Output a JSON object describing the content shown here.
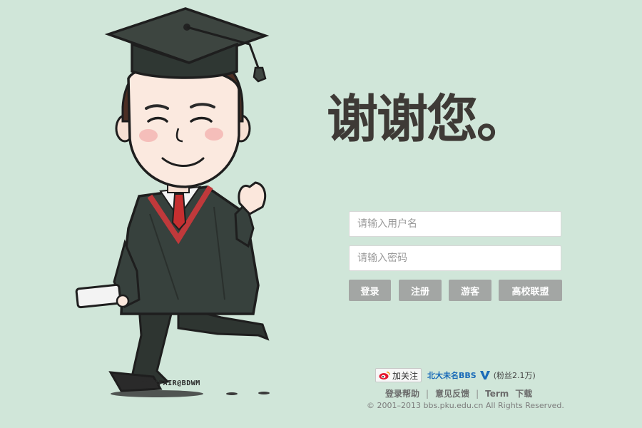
{
  "heading": "谢谢您。",
  "signature": "ZACKFAIR@BDWM",
  "login": {
    "username_placeholder": "请输入用户名",
    "password_placeholder": "请输入密码",
    "buttons": {
      "login": "登录",
      "register": "注册",
      "guest": "游客",
      "alliance": "高校联盟"
    }
  },
  "weibo": {
    "follow": "加关注",
    "account": "北大未名BBS",
    "fans": "(粉丝2.1万)"
  },
  "footer": {
    "links": [
      "登录帮助",
      "意见反馈",
      "Term",
      "下载"
    ],
    "copyright": "© 2001–2013 bbs.pku.edu.cn All Rights Reserved."
  },
  "colors": {
    "background": "#d0e6d9",
    "button": "#a3a6a4",
    "link_blue": "#1a6bb8"
  }
}
